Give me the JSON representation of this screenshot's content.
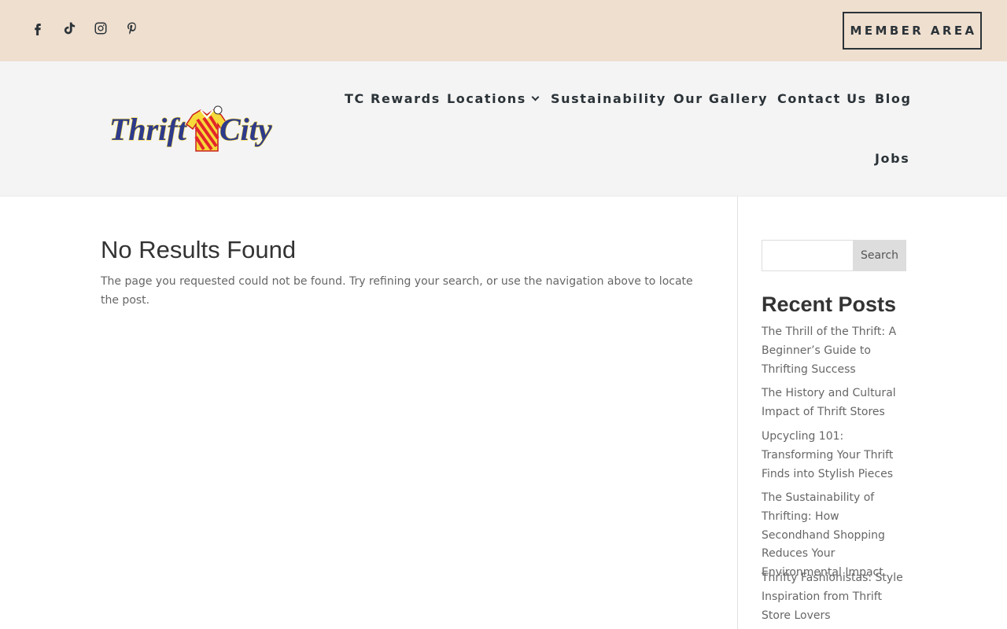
{
  "topbar": {
    "social_icons": [
      "facebook-icon",
      "tiktok-icon",
      "instagram-icon",
      "pinterest-icon"
    ],
    "member_button": "MEMBER AREA"
  },
  "header": {
    "logo_text": "Thrift City",
    "nav": {
      "rewards": "TC Rewards",
      "locations": "Locations",
      "sustainability": "Sustainability",
      "gallery": "Our Gallery",
      "contact": "Contact Us",
      "blog": "Blog",
      "jobs": "Jobs"
    }
  },
  "main": {
    "title": "No Results Found",
    "message": "The page you requested could not be found. Try refining your search, or use the navigation above to locate the post."
  },
  "sidebar": {
    "search": {
      "value": "",
      "placeholder": "",
      "button": "Search"
    },
    "recent_title": "Recent Posts",
    "posts": [
      "The Thrill of the Thrift: A Beginner’s Guide to Thrifting Success",
      "The History and Cultural Impact of Thrift Stores",
      "Upcycling 101: Transforming Your Thrift Finds into Stylish Pieces",
      "The Sustainability of Thrifting: How Secondhand Shopping Reduces Your Environmental Impact",
      "Thrifty Fashionistas: Style Inspiration from Thrift Store Lovers"
    ]
  },
  "colors": {
    "topbar_bg": "#efdfcf",
    "header_bg": "#f4f4f4",
    "nav_text": "#2b3338",
    "logo_blue": "#2e3a8c",
    "logo_yellow": "#f6d93a",
    "logo_red": "#e3262a"
  }
}
